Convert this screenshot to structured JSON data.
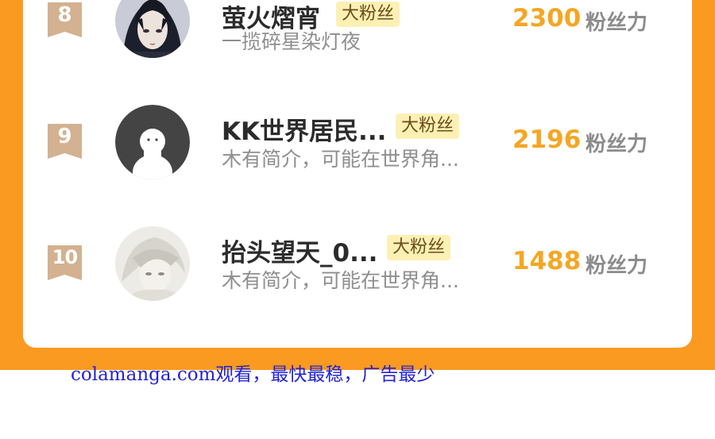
{
  "ranking": {
    "rows": [
      {
        "rank": "8",
        "nickname": "萤火熠宵",
        "tag": "大粉丝",
        "bio": "一揽碎星染灯夜",
        "score": "2300",
        "score_unit": "粉丝力",
        "avatar": "anime-portrait-dark-hair"
      },
      {
        "rank": "9",
        "nickname": "KK世界居民...",
        "tag": "大粉丝",
        "bio": "木有简介，可能在世界角...",
        "score": "2196",
        "score_unit": "粉丝力",
        "avatar": "default-silhouette"
      },
      {
        "rank": "10",
        "nickname": "抬头望天_0...",
        "tag": "大粉丝",
        "bio": "木有简介，可能在世界角...",
        "score": "1488",
        "score_unit": "粉丝力",
        "avatar": "anime-portrait-light-hair"
      }
    ]
  },
  "watermark": "colamanga.com观看，最快最稳，广告最少",
  "colors": {
    "accent_orange": "#fb9a20",
    "score_color": "#f5a623",
    "rank_badge": "#d3b191",
    "tag_bg": "#fdf0b4"
  }
}
